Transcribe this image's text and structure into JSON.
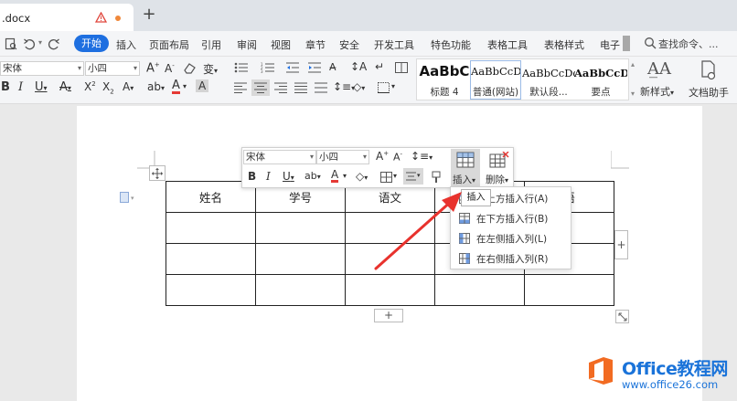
{
  "tab": {
    "title": ".docx",
    "new_tab": "+"
  },
  "menu": {
    "items": [
      "开始",
      "插入",
      "页面布局",
      "引用",
      "审阅",
      "视图",
      "章节",
      "安全",
      "开发工具",
      "特色功能",
      "表格工具",
      "表格样式",
      "电子"
    ],
    "search": "查找命令、..."
  },
  "ribbon": {
    "font_name": "宋体",
    "font_size": "小四",
    "styles": [
      {
        "sample": "AaBbC",
        "name": "标题 4"
      },
      {
        "sample": "AaBbCcDd",
        "name": "普通(网站)"
      },
      {
        "sample": "AaBbCcDd",
        "name": "默认段..."
      },
      {
        "sample": "AaBbCcDd",
        "name": "要点"
      }
    ],
    "new_style": "新样式",
    "doc_helper": "文档助手"
  },
  "table": {
    "headers": [
      "姓名",
      "学号",
      "语文",
      "",
      "语"
    ],
    "rows": [
      [
        "",
        "",
        "",
        "",
        ""
      ],
      [
        "",
        "",
        "",
        "",
        ""
      ],
      [
        "",
        "",
        "",
        "",
        ""
      ]
    ]
  },
  "floating_toolbar": {
    "font_name": "宋体",
    "font_size": "小四",
    "insert_label": "插入",
    "delete_label": "删除"
  },
  "tooltip": "插入",
  "dropdown": {
    "items": [
      "在上方插入行(A)",
      "在下方插入行(B)",
      "在左侧插入列(L)",
      "在右侧插入列(R)"
    ]
  },
  "watermark": {
    "title": "Office教程网",
    "url": "www.office26.com"
  },
  "colors": {
    "accent": "#1e6fe0",
    "arrow": "#e8322d",
    "watermark_orange": "#f26b22",
    "watermark_blue": "#1a73d9"
  }
}
